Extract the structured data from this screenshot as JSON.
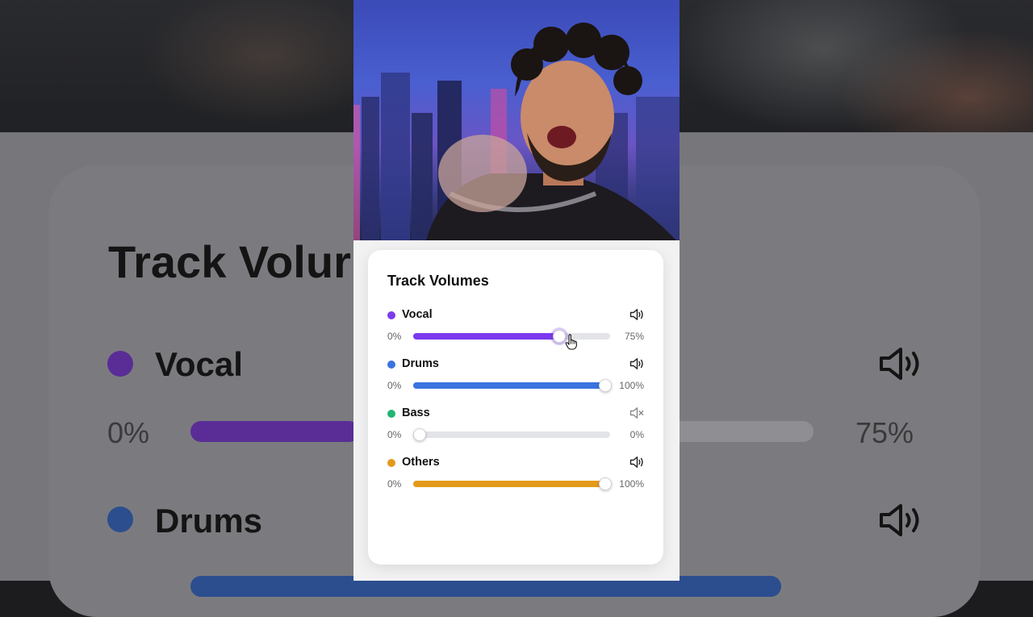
{
  "panel": {
    "title": "Track Volumes",
    "tracks": [
      {
        "name": "Vocal",
        "color": "#7c3aed",
        "volume_pct": 75,
        "min_label": "0%",
        "value_label": "75%",
        "icon": "speaker-icon",
        "muted": false
      },
      {
        "name": "Drums",
        "color": "#3b73e0",
        "volume_pct": 100,
        "min_label": "0%",
        "value_label": "100%",
        "icon": "speaker-icon",
        "muted": false
      },
      {
        "name": "Bass",
        "color": "#22b573",
        "volume_pct": 0,
        "min_label": "0%",
        "value_label": "0%",
        "icon": "speaker-muted-icon",
        "muted": true
      },
      {
        "name": "Others",
        "color": "#e39a1c",
        "volume_pct": 100,
        "min_label": "0%",
        "value_label": "100%",
        "icon": "speaker-icon",
        "muted": false
      }
    ]
  },
  "background_blur": {
    "title": "Track Volur",
    "tracks": [
      {
        "name": "Vocal",
        "color": "#5a2d96",
        "min_label": "0%",
        "value_label": "75%"
      },
      {
        "name": "Drums",
        "color": "#2c4e8e",
        "min_label": "0%",
        "value_label": "100%"
      }
    ]
  },
  "cursor": {
    "icon": "hand-pointer-icon",
    "over_track": "Vocal"
  }
}
